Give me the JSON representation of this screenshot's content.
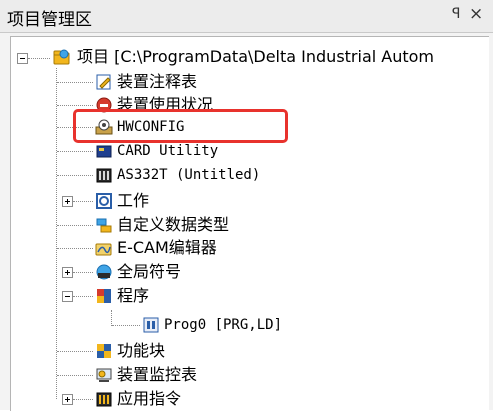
{
  "panel": {
    "title": "项目管理区",
    "pin_glyph": "ᵖ",
    "close_glyph": "×"
  },
  "tree": {
    "root_label": "项目 [C:\\ProgramData\\Delta Industrial Autom",
    "items": {
      "device_comments": "装置注释表",
      "device_usage": "装置使用状况",
      "hwconfig": "HWCONFIG",
      "card_utility": "CARD Utility",
      "as332t": "AS332T  (Untitled)",
      "task": "工作",
      "custom_data_type": "自定义数据类型",
      "ecam_editor": "E-CAM编辑器",
      "global_symbols": "全局符号",
      "program": "程序",
      "prog0": "Prog0 [PRG,LD]",
      "function_block": "功能块",
      "device_monitor": "装置监控表",
      "app_instructions": "应用指令"
    }
  },
  "colors": {
    "highlight": "#e8322d",
    "panel_bg": "#f3f3f3",
    "tree_bg": "#ffffff"
  }
}
